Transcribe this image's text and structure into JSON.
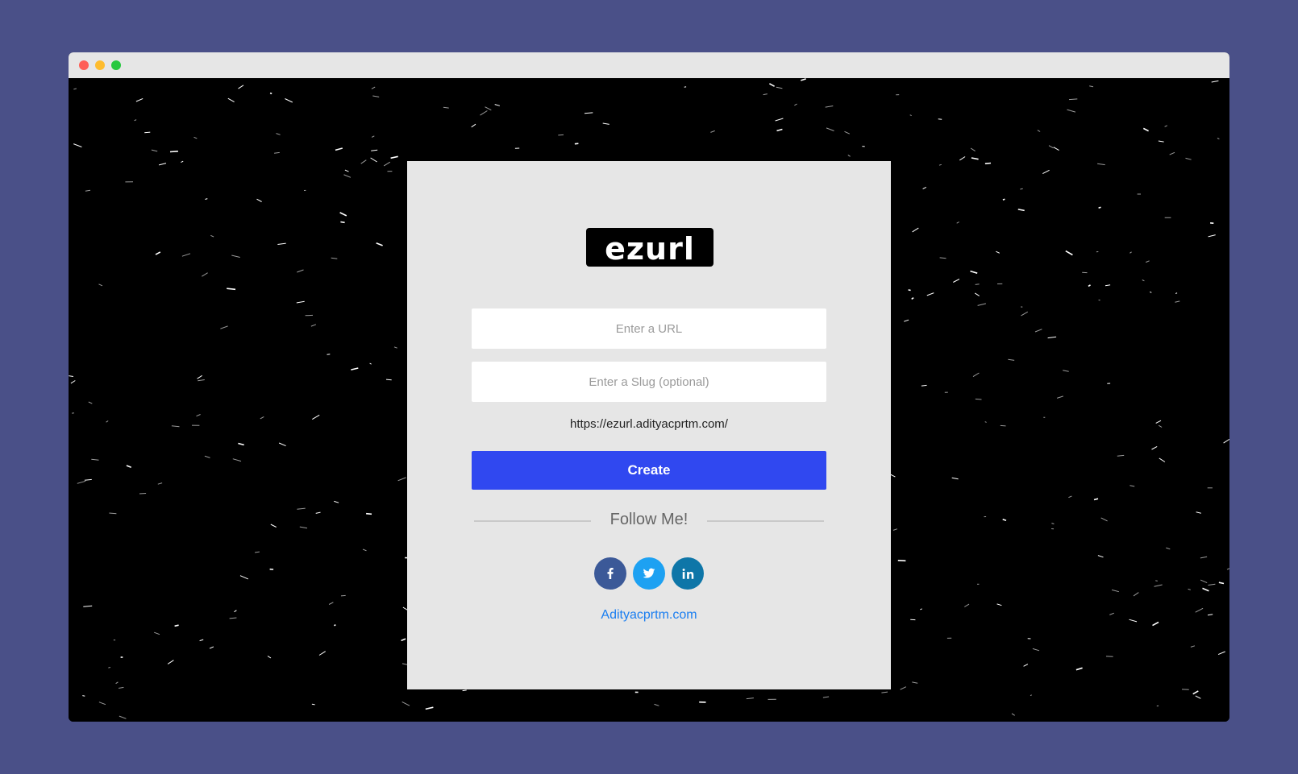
{
  "window": {
    "controls": [
      "close",
      "minimize",
      "maximize"
    ]
  },
  "brand": {
    "logo_text": "ezurl"
  },
  "form": {
    "url_placeholder": "Enter a URL",
    "slug_placeholder": "Enter a Slug (optional)",
    "url_prefix": "https://ezurl.adityacprtm.com/",
    "create_label": "Create"
  },
  "follow": {
    "heading": "Follow Me!",
    "socials": [
      {
        "icon": "facebook-icon",
        "label": "f"
      },
      {
        "icon": "twitter-icon",
        "label": "twitter"
      },
      {
        "icon": "linkedin-icon",
        "label": "in"
      }
    ],
    "site_link": "Adityacprtm.com"
  },
  "colors": {
    "page_background": "#4a5088",
    "viewport_background": "#000000",
    "card_background": "#e6e6e6",
    "button": "#3048f0",
    "link": "#1a7ef0",
    "facebook": "#3b5998",
    "twitter": "#1da1f2",
    "linkedin": "#0e76a8",
    "traffic_red": "#fe5f57",
    "traffic_yellow": "#febc2e",
    "traffic_green": "#28c840"
  }
}
